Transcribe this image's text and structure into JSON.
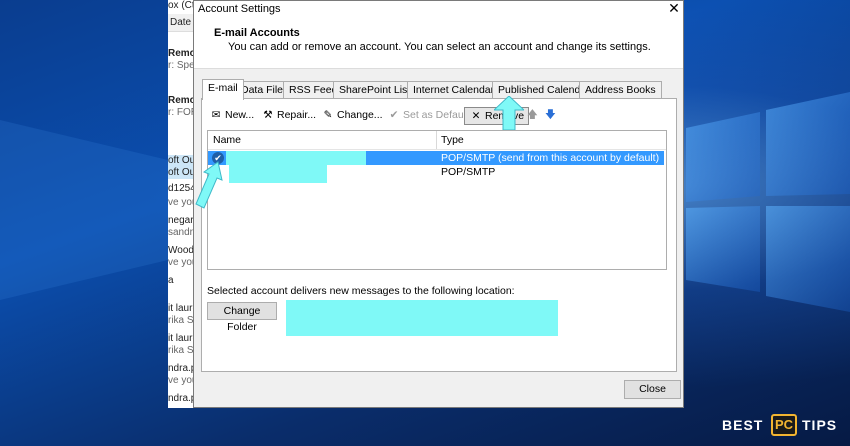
{
  "outlook_bg": {
    "column_header": "Date",
    "partial_title": "ox (Ctr",
    "rows": [
      {
        "text": "Remo",
        "style": "bold"
      },
      {
        "text": "r: Spec",
        "style": "muted"
      },
      {
        "text": "Remo",
        "style": "bold"
      },
      {
        "text": "r: FOR",
        "style": "muted"
      },
      {
        "text": "oft Ou",
        "style": "sel"
      },
      {
        "text": "oft Ou",
        "style": "sel"
      },
      {
        "text": "d1254",
        "style": ""
      },
      {
        "text": "ve you",
        "style": "muted"
      },
      {
        "text": "negar",
        "style": ""
      },
      {
        "text": "sandr",
        "style": "muted"
      },
      {
        "text": "Wood",
        "style": ""
      },
      {
        "text": "ve you",
        "style": "muted"
      },
      {
        "text": "a",
        "style": ""
      },
      {
        "text": "it laure",
        "style": ""
      },
      {
        "text": "rika S",
        "style": "muted"
      },
      {
        "text": "it laure",
        "style": ""
      },
      {
        "text": "rika S",
        "style": "muted"
      },
      {
        "text": "ndra.p",
        "style": ""
      },
      {
        "text": "ve you",
        "style": "muted"
      },
      {
        "text": "ndra.p",
        "style": ""
      }
    ]
  },
  "dialog": {
    "title": "Account Settings",
    "close_glyph": "✕",
    "header_title": "E-mail Accounts",
    "header_subtitle": "You can add or remove an account. You can select an account and change its settings.",
    "tabs": [
      "E-mail",
      "Data Files",
      "RSS Feeds",
      "SharePoint Lists",
      "Internet Calendars",
      "Published Calendars",
      "Address Books"
    ],
    "active_tab": "E-mail",
    "toolbar": {
      "new": "New...",
      "repair": "Repair...",
      "change": "Change...",
      "set_default": "Set as Default",
      "remove": "Remove",
      "up_icon": "move-up-icon",
      "down_icon": "move-down-icon"
    },
    "columns": {
      "name": "Name",
      "type": "Type"
    },
    "accounts": [
      {
        "type": "POP/SMTP (send from this account by default)",
        "selected": true,
        "is_default": true
      },
      {
        "type": "POP/SMTP",
        "selected": false,
        "is_default": false
      }
    ],
    "location_label": "Selected account delivers new messages to the following location:",
    "change_folder": "Change Folder",
    "close_button": "Close"
  },
  "annotation_color": "#7ff9f7",
  "watermark": {
    "left": "BEST",
    "box": "PC",
    "right": "TIPS"
  }
}
